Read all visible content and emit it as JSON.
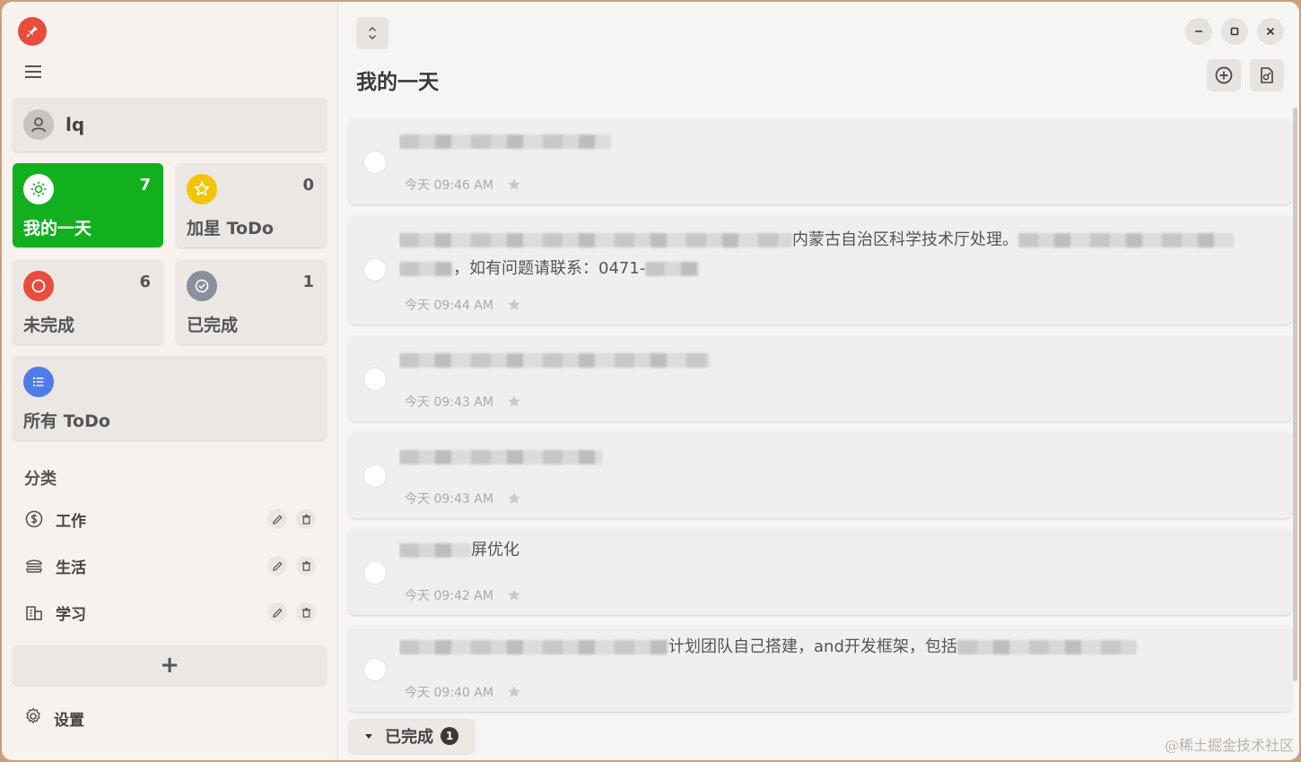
{
  "app": {
    "accent": "#e94b3c",
    "active_color": "#12b01e"
  },
  "user": {
    "name": "lq"
  },
  "smart_lists": [
    {
      "label": "我的一天",
      "count": "7",
      "icon": "sun-icon",
      "color": "#12b01e",
      "active": true
    },
    {
      "label": "加星 ToDo",
      "count": "0",
      "icon": "star-icon",
      "color": "#f2c50a"
    },
    {
      "label": "未完成",
      "count": "6",
      "icon": "circle-icon",
      "color": "#e94b3c"
    },
    {
      "label": "已完成",
      "count": "1",
      "icon": "check-circle-icon",
      "color": "#8a909c"
    },
    {
      "label": "所有 ToDo",
      "count": "",
      "icon": "list-icon",
      "color": "#4f7ce8"
    }
  ],
  "categories": {
    "title": "分类",
    "items": [
      {
        "label": "工作",
        "icon": "dollar-icon"
      },
      {
        "label": "生活",
        "icon": "burger-icon"
      },
      {
        "label": "学习",
        "icon": "building-icon"
      }
    ],
    "add_label": "+"
  },
  "settings": {
    "label": "设置"
  },
  "main": {
    "title": "我的一天",
    "tasks": [
      {
        "text_visible": "",
        "time": "今天 09:46 AM"
      },
      {
        "text_visible": "内蒙古自治区科学技术厅处理。",
        "text_visible_2": "，如有问题请联系：0471-",
        "time": "今天 09:44 AM"
      },
      {
        "text_visible": "",
        "time": "今天 09:43 AM"
      },
      {
        "text_visible": "",
        "time": "今天 09:43 AM"
      },
      {
        "text_visible": "屏优化",
        "time": "今天 09:42 AM"
      },
      {
        "text_visible": "计划团队自己搭建，and开发框架，包括",
        "time": "今天 09:40 AM"
      }
    ],
    "completed_toggle": {
      "label": "已完成",
      "count": "1"
    }
  },
  "watermark": "@稀土掘金技术社区"
}
